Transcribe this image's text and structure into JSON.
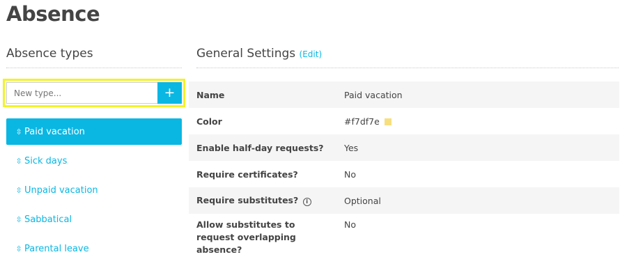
{
  "page": {
    "title": "Absence"
  },
  "absence_types": {
    "heading": "Absence types",
    "new_type_placeholder": "New type...",
    "add_button_label": "+",
    "items": [
      {
        "label": "Paid vacation",
        "active": true
      },
      {
        "label": "Sick days",
        "active": false
      },
      {
        "label": "Unpaid vacation",
        "active": false
      },
      {
        "label": "Sabbatical",
        "active": false
      },
      {
        "label": "Parental leave",
        "active": false
      }
    ],
    "drag_icon_glyph": "⇳"
  },
  "general_settings": {
    "heading": "General Settings",
    "edit_label": "(Edit)",
    "rows": [
      {
        "label": "Name",
        "value": "Paid vacation"
      },
      {
        "label": "Color",
        "value": "#f7df7e",
        "swatch_color": "#f7df7e"
      },
      {
        "label": "Enable half-day requests?",
        "value": "Yes"
      },
      {
        "label": "Require certificates?",
        "value": "No"
      },
      {
        "label": "Require substitutes?",
        "value": "Optional",
        "info_icon": "info-icon"
      },
      {
        "label": "Allow substitutes to request overlapping absence?",
        "value": "No"
      }
    ]
  },
  "colors": {
    "accent": "#0ab7e3",
    "highlight_border": "#f3f32a"
  }
}
